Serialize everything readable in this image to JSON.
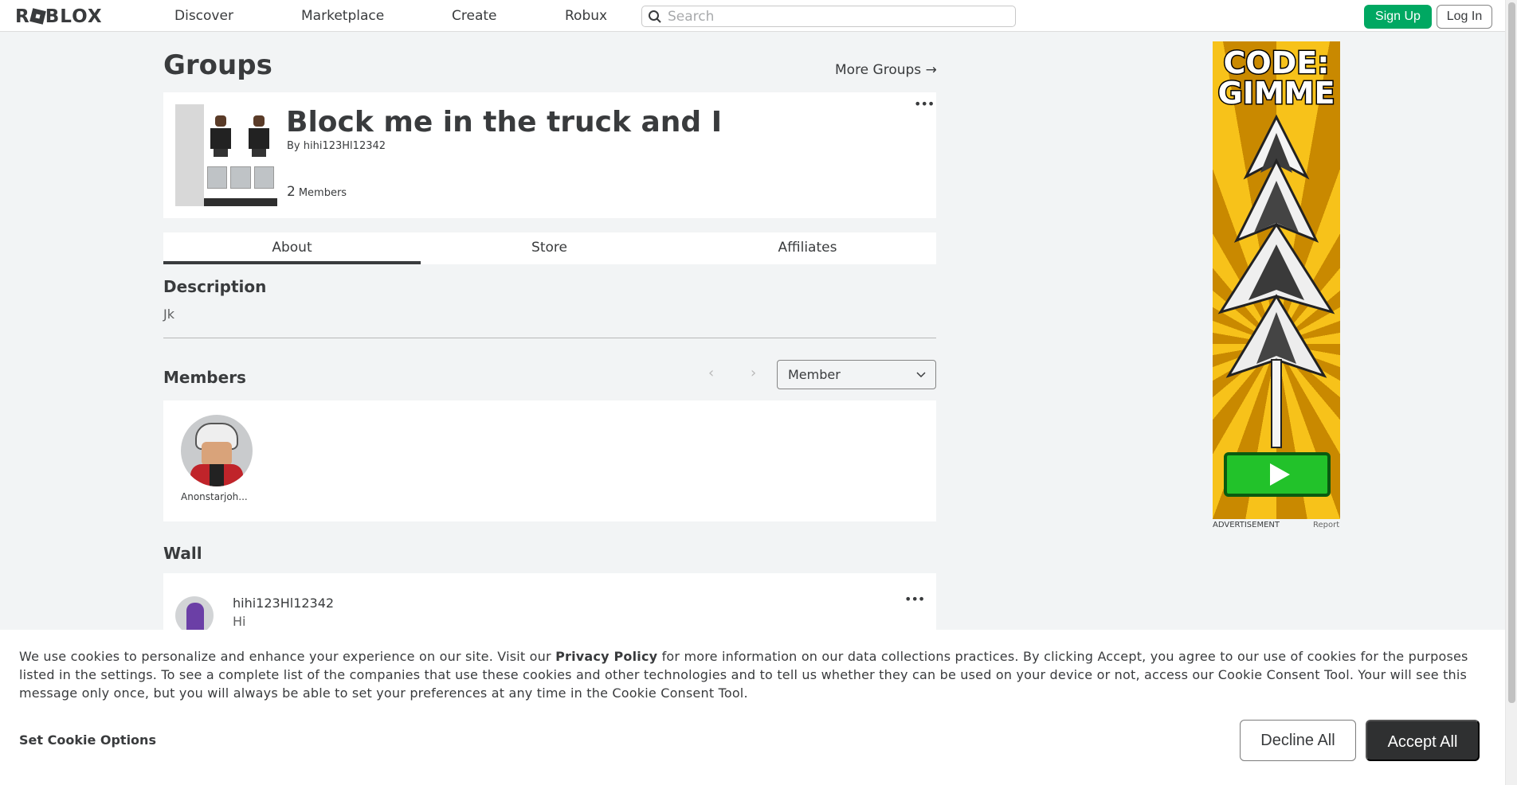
{
  "nav": {
    "logo": "ROBLOX",
    "links": [
      "Discover",
      "Marketplace",
      "Create",
      "Robux"
    ],
    "search_placeholder": "Search",
    "signup_label": "Sign Up",
    "login_label": "Log In"
  },
  "page": {
    "title": "Groups",
    "more_groups": "More Groups →"
  },
  "group": {
    "name": "Block me in the truck and I",
    "owner_prefix": "By",
    "owner": "hihi123Hl12342",
    "member_count": "2",
    "member_label": "Members"
  },
  "tabs": [
    "About",
    "Store",
    "Affiliates"
  ],
  "about": {
    "description_heading": "Description",
    "description": "Jk",
    "members_heading": "Members",
    "role_selected": "Member",
    "members": [
      {
        "name": "Anonstarjoh..."
      }
    ],
    "wall_heading": "Wall",
    "wall_posts": [
      {
        "user": "hihi123Hl12342",
        "message": "Hi"
      }
    ]
  },
  "ad": {
    "headline_1": "CODE:",
    "headline_2": "GIMME",
    "label": "ADVERTISEMENT",
    "report": "Report"
  },
  "cookie": {
    "text_1": "We use cookies to personalize and enhance your experience on our site. Visit our ",
    "privacy_link": "Privacy Policy",
    "text_2": " for more information on our data collections practices. By clicking Accept, you agree to our use of cookies for the purposes listed in the settings. To see a complete list of the companies that use these cookies and other technologies and to tell us whether they can be used on your device or not, access our Cookie Consent Tool. Your will see this message only once, but you will always be able to set your preferences at any time in the Cookie Consent Tool.",
    "set_options": "Set Cookie Options",
    "decline": "Decline All",
    "accept": "Accept All"
  },
  "colors": {
    "accent_green": "#00a862",
    "text": "#393b3d",
    "background": "#f2f4f5",
    "accept_button": "#2f3031"
  }
}
